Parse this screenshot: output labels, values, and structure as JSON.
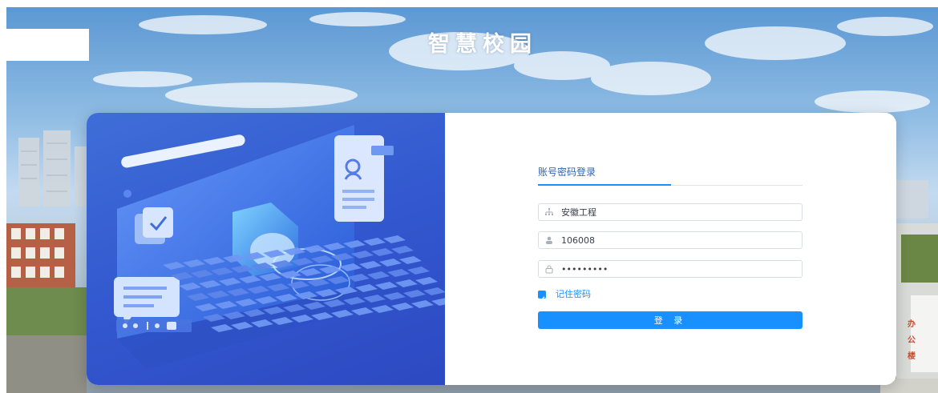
{
  "header": {
    "site_title": "智慧校园"
  },
  "login": {
    "tab_label": "账号密码登录",
    "school_field": {
      "value": "安徽工程",
      "icon": "sitemap-icon"
    },
    "username_field": {
      "value": "106008",
      "icon": "user-icon"
    },
    "password_field": {
      "value": "*********",
      "icon": "lock-icon"
    },
    "remember_password": {
      "label": "记住密码",
      "checked": true
    },
    "submit_label": "登 录"
  },
  "background_signage": {
    "lines": [
      "办",
      "公",
      "楼"
    ]
  },
  "colors": {
    "accent": "#1890ff",
    "illustration_panel": "#3358cf",
    "tab_text": "#2e63b2"
  }
}
